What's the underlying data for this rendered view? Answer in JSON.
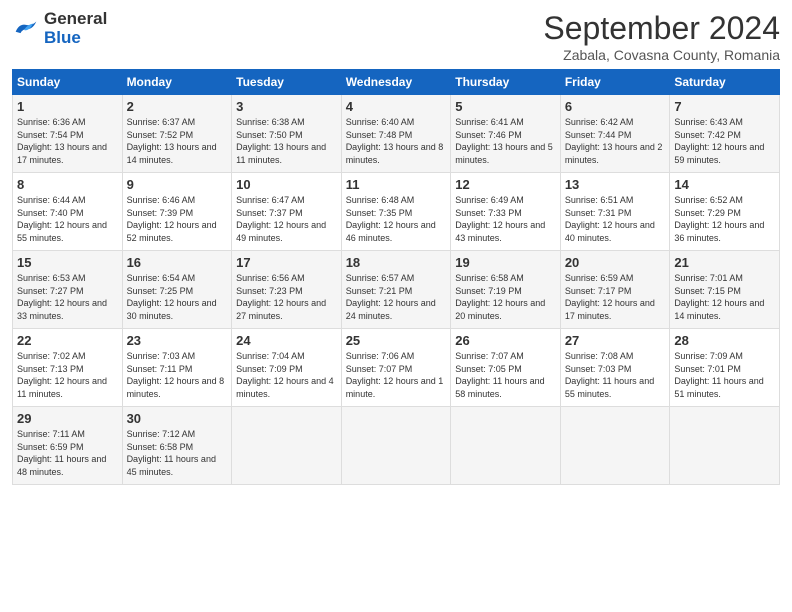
{
  "header": {
    "logo": {
      "general": "General",
      "blue": "Blue"
    },
    "title": "September 2024",
    "subtitle": "Zabala, Covasna County, Romania"
  },
  "weekdays": [
    "Sunday",
    "Monday",
    "Tuesday",
    "Wednesday",
    "Thursday",
    "Friday",
    "Saturday"
  ],
  "weeks": [
    [
      {
        "day": "1",
        "sunrise": "6:36 AM",
        "sunset": "7:54 PM",
        "daylight": "13 hours and 17 minutes."
      },
      {
        "day": "2",
        "sunrise": "6:37 AM",
        "sunset": "7:52 PM",
        "daylight": "13 hours and 14 minutes."
      },
      {
        "day": "3",
        "sunrise": "6:38 AM",
        "sunset": "7:50 PM",
        "daylight": "13 hours and 11 minutes."
      },
      {
        "day": "4",
        "sunrise": "6:40 AM",
        "sunset": "7:48 PM",
        "daylight": "13 hours and 8 minutes."
      },
      {
        "day": "5",
        "sunrise": "6:41 AM",
        "sunset": "7:46 PM",
        "daylight": "13 hours and 5 minutes."
      },
      {
        "day": "6",
        "sunrise": "6:42 AM",
        "sunset": "7:44 PM",
        "daylight": "13 hours and 2 minutes."
      },
      {
        "day": "7",
        "sunrise": "6:43 AM",
        "sunset": "7:42 PM",
        "daylight": "12 hours and 59 minutes."
      }
    ],
    [
      {
        "day": "8",
        "sunrise": "6:44 AM",
        "sunset": "7:40 PM",
        "daylight": "12 hours and 55 minutes."
      },
      {
        "day": "9",
        "sunrise": "6:46 AM",
        "sunset": "7:39 PM",
        "daylight": "12 hours and 52 minutes."
      },
      {
        "day": "10",
        "sunrise": "6:47 AM",
        "sunset": "7:37 PM",
        "daylight": "12 hours and 49 minutes."
      },
      {
        "day": "11",
        "sunrise": "6:48 AM",
        "sunset": "7:35 PM",
        "daylight": "12 hours and 46 minutes."
      },
      {
        "day": "12",
        "sunrise": "6:49 AM",
        "sunset": "7:33 PM",
        "daylight": "12 hours and 43 minutes."
      },
      {
        "day": "13",
        "sunrise": "6:51 AM",
        "sunset": "7:31 PM",
        "daylight": "12 hours and 40 minutes."
      },
      {
        "day": "14",
        "sunrise": "6:52 AM",
        "sunset": "7:29 PM",
        "daylight": "12 hours and 36 minutes."
      }
    ],
    [
      {
        "day": "15",
        "sunrise": "6:53 AM",
        "sunset": "7:27 PM",
        "daylight": "12 hours and 33 minutes."
      },
      {
        "day": "16",
        "sunrise": "6:54 AM",
        "sunset": "7:25 PM",
        "daylight": "12 hours and 30 minutes."
      },
      {
        "day": "17",
        "sunrise": "6:56 AM",
        "sunset": "7:23 PM",
        "daylight": "12 hours and 27 minutes."
      },
      {
        "day": "18",
        "sunrise": "6:57 AM",
        "sunset": "7:21 PM",
        "daylight": "12 hours and 24 minutes."
      },
      {
        "day": "19",
        "sunrise": "6:58 AM",
        "sunset": "7:19 PM",
        "daylight": "12 hours and 20 minutes."
      },
      {
        "day": "20",
        "sunrise": "6:59 AM",
        "sunset": "7:17 PM",
        "daylight": "12 hours and 17 minutes."
      },
      {
        "day": "21",
        "sunrise": "7:01 AM",
        "sunset": "7:15 PM",
        "daylight": "12 hours and 14 minutes."
      }
    ],
    [
      {
        "day": "22",
        "sunrise": "7:02 AM",
        "sunset": "7:13 PM",
        "daylight": "12 hours and 11 minutes."
      },
      {
        "day": "23",
        "sunrise": "7:03 AM",
        "sunset": "7:11 PM",
        "daylight": "12 hours and 8 minutes."
      },
      {
        "day": "24",
        "sunrise": "7:04 AM",
        "sunset": "7:09 PM",
        "daylight": "12 hours and 4 minutes."
      },
      {
        "day": "25",
        "sunrise": "7:06 AM",
        "sunset": "7:07 PM",
        "daylight": "12 hours and 1 minute."
      },
      {
        "day": "26",
        "sunrise": "7:07 AM",
        "sunset": "7:05 PM",
        "daylight": "11 hours and 58 minutes."
      },
      {
        "day": "27",
        "sunrise": "7:08 AM",
        "sunset": "7:03 PM",
        "daylight": "11 hours and 55 minutes."
      },
      {
        "day": "28",
        "sunrise": "7:09 AM",
        "sunset": "7:01 PM",
        "daylight": "11 hours and 51 minutes."
      }
    ],
    [
      {
        "day": "29",
        "sunrise": "7:11 AM",
        "sunset": "6:59 PM",
        "daylight": "11 hours and 48 minutes."
      },
      {
        "day": "30",
        "sunrise": "7:12 AM",
        "sunset": "6:58 PM",
        "daylight": "11 hours and 45 minutes."
      },
      null,
      null,
      null,
      null,
      null
    ]
  ]
}
